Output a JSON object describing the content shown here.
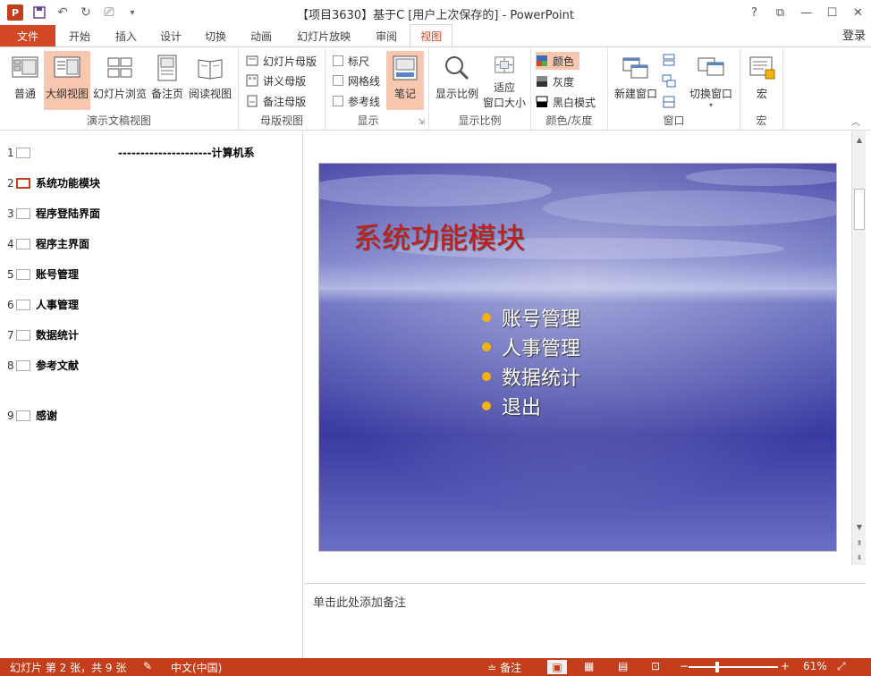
{
  "window": {
    "title": "【项目3630】基于C [用户上次保存的] - PowerPoint",
    "app_logo": "P",
    "controls": [
      "?",
      "⧉",
      "—",
      "☐",
      "✕"
    ],
    "login": "登录"
  },
  "tabs": [
    "文件",
    "开始",
    "插入",
    "设计",
    "切换",
    "动画",
    "幻灯片放映",
    "审阅",
    "视图"
  ],
  "active_tab": "视图",
  "ribbon": {
    "presentation_views": {
      "label": "演示文稿视图",
      "buttons": [
        "普通",
        "大纲视图",
        "幻灯片浏览",
        "备注页",
        "阅读视图"
      ],
      "selected": "大纲视图"
    },
    "master_views": {
      "label": "母版视图",
      "buttons": [
        "幻灯片母版",
        "讲义母版",
        "备注母版"
      ]
    },
    "show": {
      "label": "显示",
      "checks": [
        "标尺",
        "网格线",
        "参考线"
      ],
      "notes_button": "笔记"
    },
    "zoom": {
      "label": "显示比例",
      "zoom_button": "显示比例",
      "fit_button_line1": "适应",
      "fit_button_line2": "窗口大小"
    },
    "color": {
      "label": "颜色/灰度",
      "options": [
        "颜色",
        "灰度",
        "黑白模式"
      ],
      "selected": "颜色"
    },
    "window": {
      "label": "窗口",
      "new_window": "新建窗口",
      "switch_window": "切换窗口"
    },
    "macro": {
      "label": "宏",
      "button": "宏"
    }
  },
  "outline": [
    {
      "num": "1",
      "text": "---------------------计算机系"
    },
    {
      "num": "2",
      "text": "系统功能模块"
    },
    {
      "num": "3",
      "text": "程序登陆界面"
    },
    {
      "num": "4",
      "text": "程序主界面"
    },
    {
      "num": "5",
      "text": "账号管理"
    },
    {
      "num": "6",
      "text": "人事管理"
    },
    {
      "num": "7",
      "text": "数据统计"
    },
    {
      "num": "8",
      "text": "参考文献"
    },
    {
      "num": "9",
      "text": "感谢"
    }
  ],
  "slide": {
    "title": "系统功能模块",
    "bullets": [
      "账号管理",
      "人事管理",
      "数据统计",
      "退出"
    ]
  },
  "notes_placeholder": "单击此处添加备注",
  "status": {
    "slide_info": "幻灯片 第 2 张，共 9 张",
    "language": "中文(中国)",
    "notes": "备注",
    "zoom": "61%"
  },
  "colors": {
    "accent": "#d24726",
    "status_bar": "#c43e1c",
    "selected_bg": "#f7c7b0",
    "slide_title": "#c51d1d",
    "bullet_dot": "#f5b10c"
  }
}
